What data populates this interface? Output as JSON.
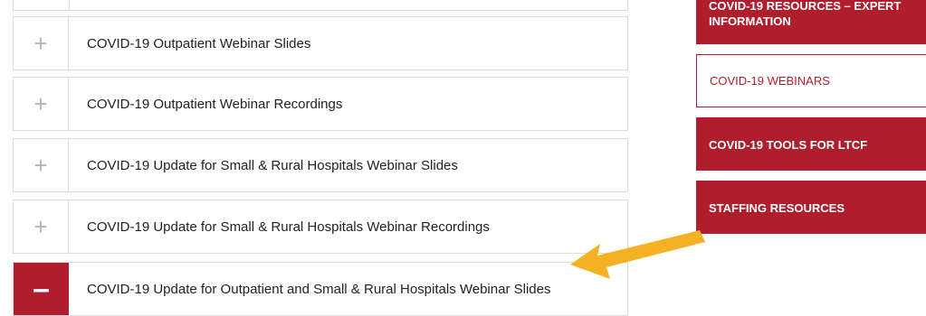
{
  "accordion": {
    "items": [
      {
        "toggle": "+",
        "title": "COVID-19 Outpatient Webinar Slides"
      },
      {
        "toggle": "+",
        "title": "COVID-19 Outpatient Webinar Recordings"
      },
      {
        "toggle": "+",
        "title": "COVID-19 Update for Small & Rural Hospitals Webinar Slides"
      },
      {
        "toggle": "+",
        "title": "COVID-19 Update for Small & Rural Hospitals Webinar Recordings"
      },
      {
        "toggle": "–",
        "title": "COVID-19 Update for Outpatient and Small & Rural Hospitals Webinar Slides"
      }
    ]
  },
  "sidebar": {
    "items": [
      {
        "label_top": "COVID-19 RESOURCES – EXPERT",
        "label": "INFORMATION"
      },
      {
        "label": "COVID-19 WEBINARS"
      },
      {
        "label": "COVID-19 TOOLS FOR LTCF"
      },
      {
        "label": "STAFFING RESOURCES"
      }
    ]
  },
  "colors": {
    "brand_red": "#b01e2e",
    "annotation_arrow": "#f4b223"
  }
}
